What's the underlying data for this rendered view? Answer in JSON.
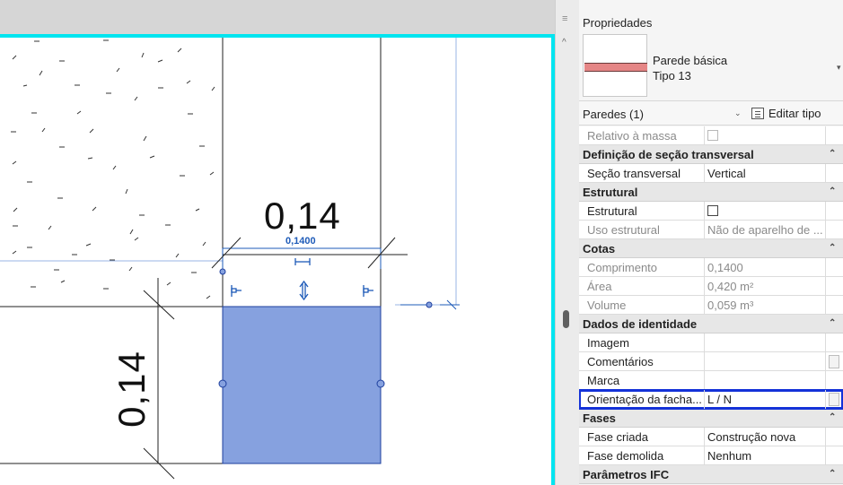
{
  "canvas": {
    "dimension_top": "0,14",
    "dimension_top_small": "0,1400",
    "dimension_left": "0,14"
  },
  "properties": {
    "title": "Propriedades",
    "type_family": "Parede básica",
    "type_name": "Tipo 13",
    "filter_label": "Paredes (1)",
    "edit_type_label": "Editar tipo",
    "rows": {
      "relativo_massa": "Relativo à massa",
      "group_secao": "Definição de seção transversal",
      "secao_label": "Seção transversal",
      "secao_value": "Vertical",
      "group_estrutural": "Estrutural",
      "estrutural_label": "Estrutural",
      "uso_label": "Uso estrutural",
      "uso_value": "Não de aparelho de ...",
      "group_cotas": "Cotas",
      "comprimento_label": "Comprimento",
      "comprimento_value": "0,1400",
      "area_label": "Área",
      "area_value": "0,420 m²",
      "volume_label": "Volume",
      "volume_value": "0,059 m³",
      "group_identidade": "Dados de identidade",
      "imagem_label": "Imagem",
      "comentarios_label": "Comentários",
      "marca_label": "Marca",
      "orientacao_label": "Orientação da facha...",
      "orientacao_value": "L / N",
      "group_fases": "Fases",
      "fase_criada_label": "Fase criada",
      "fase_criada_value": "Construção nova",
      "fase_demolida_label": "Fase demolida",
      "fase_demolida_value": "Nenhum",
      "group_ifc": "Parâmetros IFC"
    }
  },
  "icons": {
    "collapse": "double-chevron-up-icon",
    "dropdown": "chevron-down-icon",
    "edit_type": "edit-type-icon",
    "panel_menu": "menu-icon"
  },
  "colors": {
    "selected_wall_fill": "#86a1df",
    "view_border": "#00e5f0",
    "highlight_outline": "#1432d8",
    "wall_swatch": "#e58686"
  }
}
